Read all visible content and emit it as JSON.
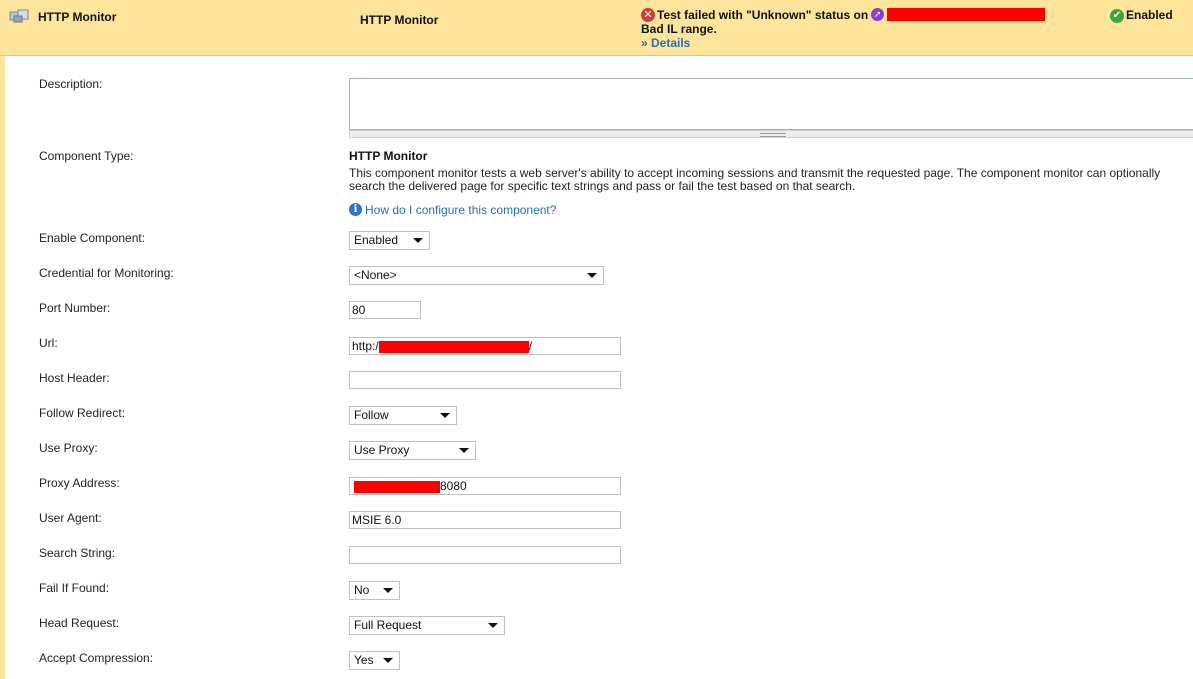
{
  "header": {
    "title": "HTTP Monitor",
    "center_title": "HTTP Monitor",
    "status_text": "Test failed with \"Unknown\" status on",
    "status_detail": "Bad IL range.",
    "details_link": "» Details",
    "state": "Enabled"
  },
  "form": {
    "description": {
      "label": "Description:",
      "value": ""
    },
    "component_type": {
      "label": "Component Type:",
      "name": "HTTP Monitor",
      "description": "This component monitor tests a web server's ability to accept incoming sessions and transmit the requested page. The component monitor can optionally search the delivered page for specific text strings and pass or fail the test based on that search.",
      "help_link": "How do I configure this component?"
    },
    "enable_component": {
      "label": "Enable Component:",
      "value": "Enabled"
    },
    "credential": {
      "label": "Credential for Monitoring:",
      "value": "<None>"
    },
    "port_number": {
      "label": "Port Number:",
      "value": "80"
    },
    "url": {
      "label": "Url:",
      "prefix": "http:/",
      "suffix": "/"
    },
    "host_header": {
      "label": "Host Header:",
      "value": ""
    },
    "follow_redirect": {
      "label": "Follow Redirect:",
      "value": "Follow"
    },
    "use_proxy": {
      "label": "Use Proxy:",
      "value": "Use Proxy"
    },
    "proxy_address": {
      "label": "Proxy Address:",
      "suffix": "8080"
    },
    "user_agent": {
      "label": "User Agent:",
      "value": "MSIE 6.0"
    },
    "search_string": {
      "label": "Search String:",
      "value": ""
    },
    "fail_if_found": {
      "label": "Fail If Found:",
      "value": "No"
    },
    "head_request": {
      "label": "Head Request:",
      "value": "Full Request"
    },
    "accept_compression": {
      "label": "Accept Compression:",
      "value": "Yes"
    }
  },
  "colors": {
    "header_bg": "#fde59b",
    "link": "#2a6eb5",
    "error": "#d43b3b",
    "ok": "#3aa83a",
    "redaction": "#ff0000"
  },
  "icons": [
    "component-icon",
    "error-icon",
    "node-icon",
    "ok-check-icon",
    "info-icon",
    "chevron-down-icon"
  ]
}
